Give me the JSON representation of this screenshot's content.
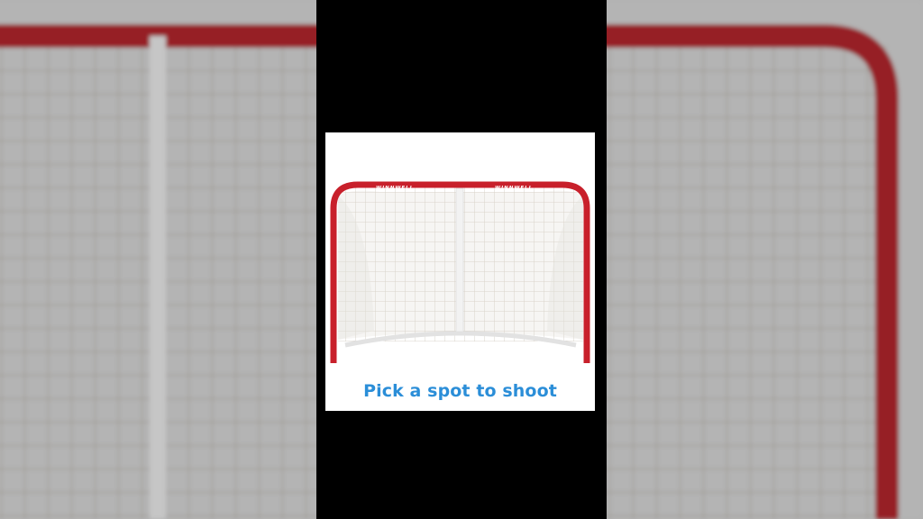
{
  "prompt": {
    "text": "Pick a spot to shoot"
  },
  "goal": {
    "brand": "WINNWELL",
    "frame_color": "#c8202b",
    "net_color": "#e9e6e2"
  },
  "colors": {
    "accent": "#2b8ed8",
    "background": "#000000",
    "card": "#ffffff"
  }
}
